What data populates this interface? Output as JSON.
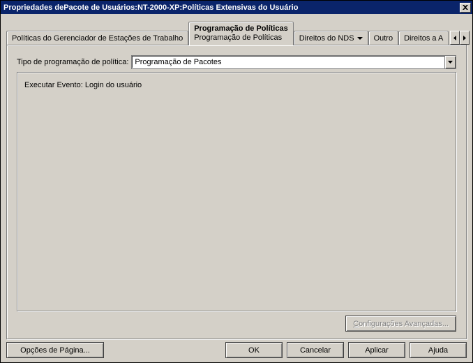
{
  "window": {
    "title": "Propriedades dePacote de Usuários:NT-2000-XP:Políticas Extensivas do Usuário"
  },
  "tabs": {
    "workstation": "Políticas do Gerenciador de Estações de Trabalho",
    "scheduling_main": "Programação de Políticas",
    "scheduling_sub": "Programação de Políticas",
    "nds_rights": "Direitos do NDS",
    "other": "Outro",
    "rights_to": "Direitos a A"
  },
  "panel": {
    "type_label": "Tipo de programação de política:",
    "combo_value": "Programação de Pacotes",
    "event_text": "Executar Evento: Login do usuário",
    "advanced_btn": "Configurações Avançadas..."
  },
  "footer": {
    "page_options": "Opções de Página...",
    "ok": "OK",
    "cancel": "Cancelar",
    "apply": "Aplicar",
    "help": "Ajuda"
  }
}
